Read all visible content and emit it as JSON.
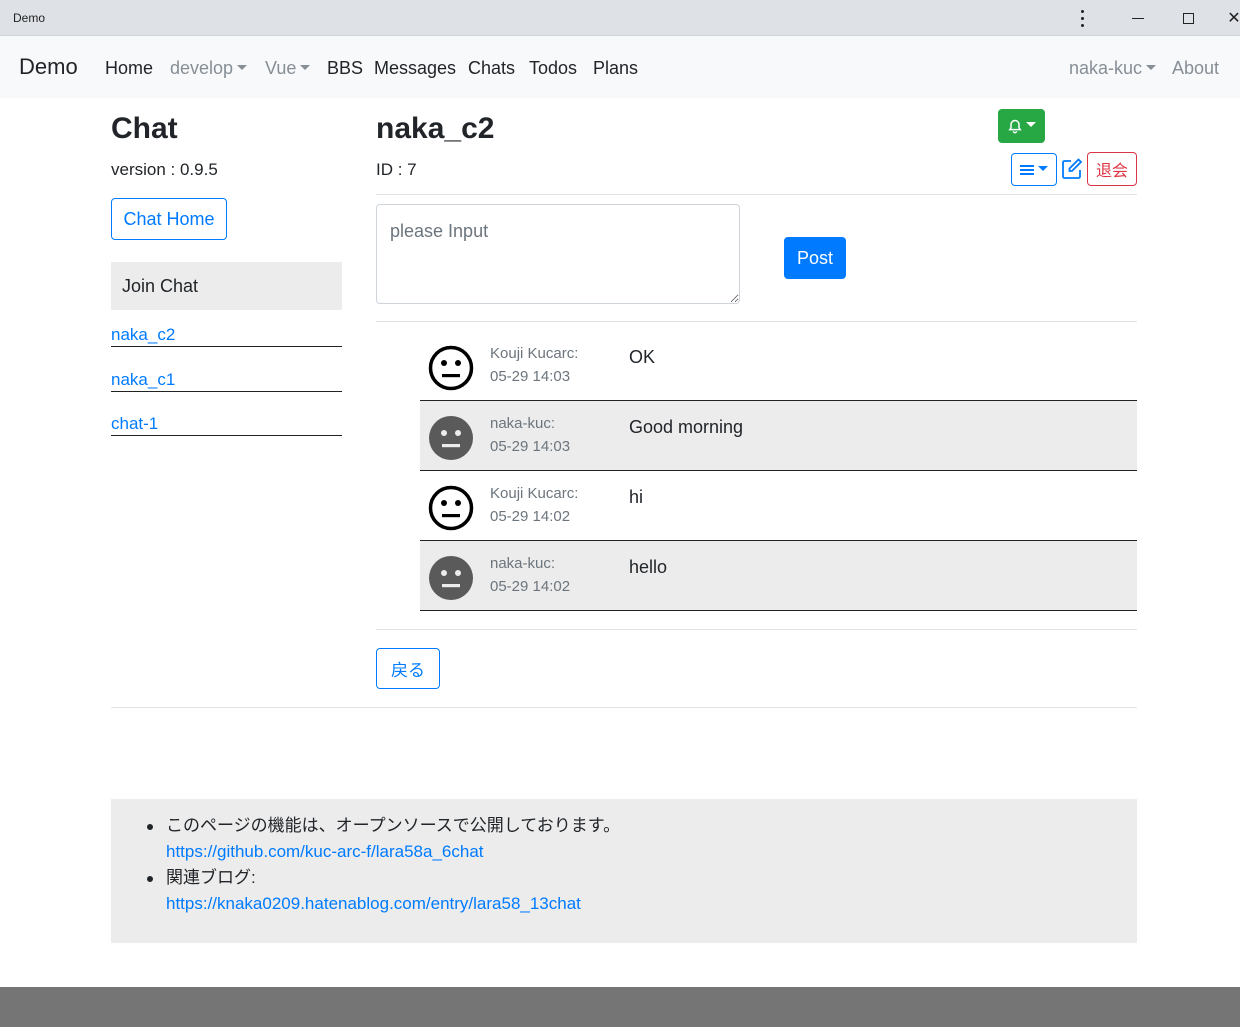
{
  "window": {
    "title": "Demo"
  },
  "nav": {
    "brand": "Demo",
    "items": [
      "Home",
      "develop",
      "Vue",
      "BBS",
      "Messages",
      "Chats",
      "Todos",
      "Plans"
    ],
    "user": "naka-kuc",
    "about": "About"
  },
  "sidebar": {
    "title": "Chat",
    "version": "version : 0.9.5",
    "home_button": "Chat Home",
    "join_header": "Join Chat",
    "rooms": [
      "naka_c2",
      "naka_c1",
      "chat-1"
    ]
  },
  "room": {
    "name": "naka_c2",
    "id_label": "ID : 7",
    "leave_label": "退会"
  },
  "composer": {
    "placeholder": "please Input",
    "post_label": "Post"
  },
  "messages": [
    {
      "sender": "Kouji Kucarc:",
      "time": "05-29 14:03",
      "text": "OK",
      "mine": false
    },
    {
      "sender": "naka-kuc:",
      "time": "05-29 14:03",
      "text": "Good morning",
      "mine": true
    },
    {
      "sender": "Kouji Kucarc:",
      "time": "05-29 14:02",
      "text": "hi",
      "mine": false
    },
    {
      "sender": "naka-kuc:",
      "time": "05-29 14:02",
      "text": "hello",
      "mine": true
    }
  ],
  "back_label": "戻る",
  "footer": {
    "line1": "このページの機能は、オープンソースで公開しております。",
    "link1": "https://github.com/kuc-arc-f/lara58a_6chat",
    "line2": "関連ブログ:",
    "link2": "https://knaka0209.hatenablog.com/entry/lara58_13chat"
  },
  "colors": {
    "primary": "#007bff",
    "success": "#28a745",
    "danger": "#dc3545"
  }
}
